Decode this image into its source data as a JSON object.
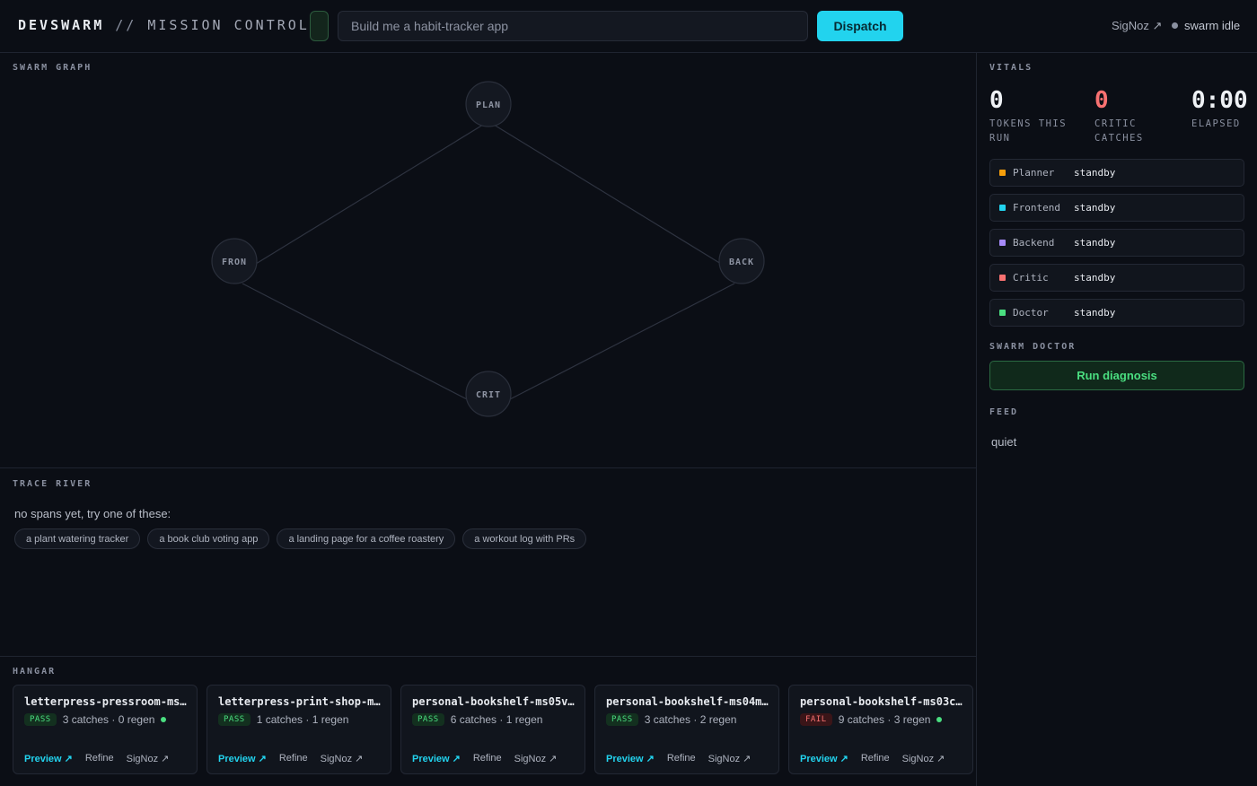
{
  "header": {
    "brand_main": "DEVSWARM",
    "brand_sep": " // ",
    "brand_sub": "MISSION CONTROL",
    "prompt_placeholder": "Build me a habit-tracker app",
    "dispatch_label": "Dispatch",
    "signoz_label": "SigNoz ↗",
    "status_label": "swarm idle"
  },
  "graph": {
    "label": "SWARM GRAPH",
    "nodes": {
      "plan": "PLAN",
      "front": "FRON",
      "back": "BACK",
      "crit": "CRIT"
    }
  },
  "trace": {
    "label": "TRACE RIVER",
    "empty_message": "no spans yet, try one of these:",
    "suggestions": [
      "a plant watering tracker",
      "a book club voting app",
      "a landing page for a coffee roastery",
      "a workout log with PRs"
    ]
  },
  "hangar": {
    "label": "HANGAR",
    "cards": [
      {
        "title": "letterpress-pressroom-ms0…",
        "status": "PASS",
        "meta": "3 catches · 0 regen",
        "live": true
      },
      {
        "title": "letterpress-print-shop-ms…",
        "status": "PASS",
        "meta": "1 catches · 1 regen",
        "live": false
      },
      {
        "title": "personal-bookshelf-ms05vf…",
        "status": "PASS",
        "meta": "6 catches · 1 regen",
        "live": false
      },
      {
        "title": "personal-bookshelf-ms04mc…",
        "status": "PASS",
        "meta": "3 catches · 2 regen",
        "live": false
      },
      {
        "title": "personal-bookshelf-ms03c8…",
        "status": "FAIL",
        "meta": "9 catches · 3 regen",
        "live": true
      }
    ],
    "actions": {
      "preview": "Preview ↗",
      "refine": "Refine",
      "signoz": "SigNoz ↗"
    }
  },
  "vitals": {
    "label": "VITALS",
    "tokens": {
      "value": "0",
      "label_1": "TOKENS THIS",
      "label_2": "RUN"
    },
    "catches": {
      "value": "0",
      "label_1": "CRITIC",
      "label_2": "CATCHES"
    },
    "elapsed": {
      "value": "0:00",
      "label_1": "ELAPSED"
    },
    "agents": [
      {
        "name": "Planner",
        "state": "standby",
        "color": "#f59e0b"
      },
      {
        "name": "Frontend",
        "state": "standby",
        "color": "#22d3ee"
      },
      {
        "name": "Backend",
        "state": "standby",
        "color": "#a78bfa"
      },
      {
        "name": "Critic",
        "state": "standby",
        "color": "#f87171"
      },
      {
        "name": "Doctor",
        "state": "standby",
        "color": "#4ade80"
      }
    ]
  },
  "doctor": {
    "label": "SWARM DOCTOR",
    "button_label": "Run diagnosis"
  },
  "feed": {
    "label": "FEED",
    "empty": "quiet"
  },
  "colors": {
    "accent": "#22d3ee",
    "pass": "#4ade80",
    "fail": "#f87171"
  }
}
